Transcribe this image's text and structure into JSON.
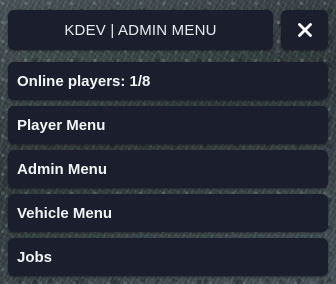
{
  "header": {
    "title": "KDEV | ADMIN MENU",
    "close_icon": "close-icon"
  },
  "menu": {
    "online_players": "Online players: 1/8",
    "items": [
      {
        "label": "Player Menu"
      },
      {
        "label": "Admin Menu"
      },
      {
        "label": "Vehicle Menu"
      },
      {
        "label": "Jobs"
      }
    ]
  },
  "colors": {
    "panel": "#1b1f2d",
    "text": "#f2f3f7",
    "icon": "#ffffff"
  }
}
